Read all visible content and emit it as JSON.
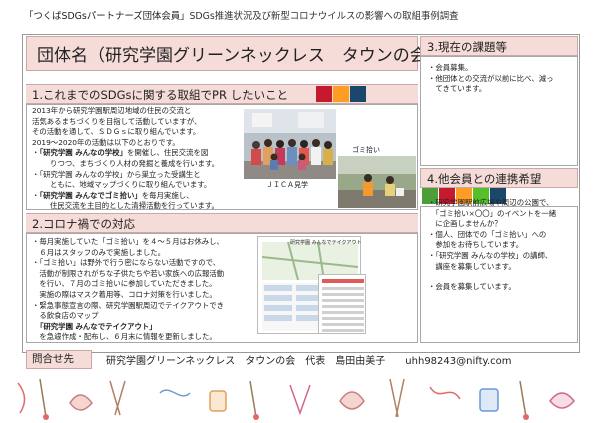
{
  "header": {
    "program": "「つくばSDGsパートナーズ団体会員」",
    "subtitle": "SDGs推進状況及び新型コロナウイルスの影響への取組事例調査"
  },
  "org_title": "団体名（研究学園グリーンネックレス　タウンの会）",
  "sections": {
    "s1": {
      "heading": "1.これまでのSDGsに関する取組でPR したいこと",
      "lines": [
        "2013年から研究学園駅周辺地域の住民の交流と",
        "活気あるまちづくりを目指して活動していますが、",
        "その活動を通して、ＳＤＧｓに取り組んでいます。",
        "2019～2020年の活動は以下のとおりです。"
      ],
      "bullets": [
        {
          "bold": "「研究学園 みんなの学校」",
          "rest": "を開催し、住民交流を図",
          "cont": "りつつ、まちづくり人材の発掘と養成を行います。"
        },
        {
          "bold": "",
          "rest": "「研究学園 みんなの学校」から巣立った受講生と",
          "cont": "ともに、地域マップづくりに取り組んでいます。"
        },
        {
          "bold": "「研究学園 みんなでゴミ拾い」",
          "rest": "を毎月実施し、",
          "cont": "住民交流を主目的とした清掃活動を行っています。"
        }
      ],
      "caption_photo1": "ＪＩＣＡ見学",
      "caption_photo2": "ゴミ拾い"
    },
    "s2": {
      "heading": "2.コロナ禍での対応",
      "lines": [
        "・毎月実施していた「ゴミ拾い」を４～５月はお休みし、",
        "　６月はスタッフのみで実施しました。",
        "・「ゴミ拾い」は野外で行う密にならない活動ですので、",
        "　活動が制限されがちな子供たちや若い家族への広報活動",
        "　を行い、７月のゴミ拾いに参加していただきました。",
        "　実施の際はマスク着用等、コロナ対策を行いました。",
        "・緊急事態宣言の際、研究学園駅周辺でテイクアウトでき",
        "　る飲食店のマップ"
      ],
      "map_bold": "「研究学園 みんなでテイクアウト」",
      "last_line": "　を急遽作成・配布し、６月末に情報を更新しました。",
      "map_title": "研究学園 みんなでテイクアウト"
    },
    "s3": {
      "heading": "3.現在の課題等",
      "lines": [
        "・会員募集。",
        "・他団体との交流が以前に比べ、減っ",
        "　てきています。"
      ]
    },
    "s4": {
      "heading": "4.他会員との連携希望",
      "lines": [
        "・研究学園駅前広場や周辺の公園で、",
        "　「ゴミ拾い×〇〇」のイベントを一緒",
        "　に企画しませんか？",
        "・個人、団体での「ゴミ拾い」への",
        "　参加をお待ちしています。",
        "・「研究学園 みんなの学校」の講師、",
        "　講座を募集しています。",
        "",
        "・会員を募集しています。"
      ]
    }
  },
  "contact": {
    "label": "問合せ先",
    "value": "研究学園グリーンネックレス　タウンの会　代表　島田由美子　　uhh98243@nifty.com"
  },
  "colors": {
    "section_bg": "#f5dcd9",
    "sdg_colors": [
      "#e5243b",
      "#dda63a",
      "#4c9f38",
      "#c5192d",
      "#ff3a21",
      "#26bde2",
      "#fcc30b",
      "#a21942",
      "#fd6925",
      "#dd1367",
      "#fd9d24",
      "#bf8b2e",
      "#3f7e44",
      "#0a97d9",
      "#56c02b",
      "#00689d",
      "#19486a"
    ]
  }
}
